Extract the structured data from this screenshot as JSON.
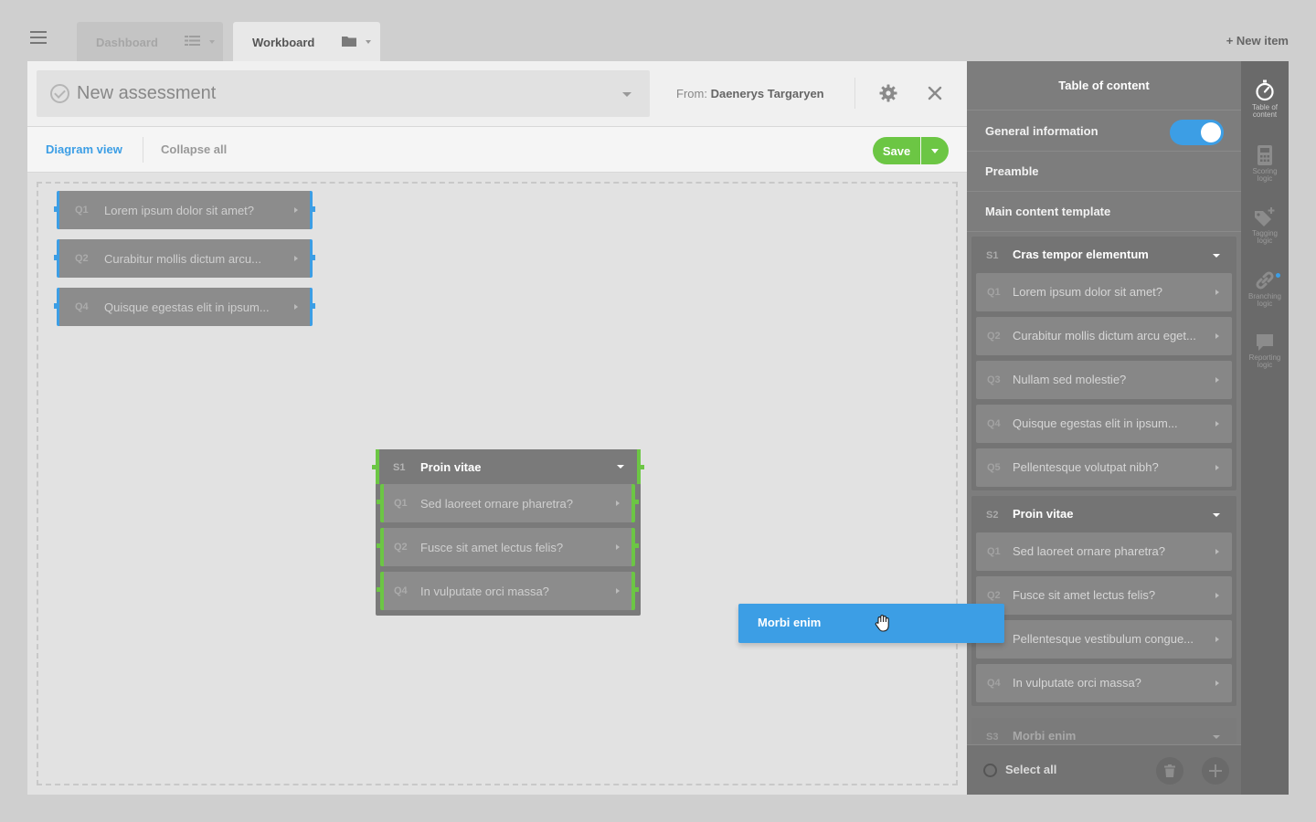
{
  "topbar": {
    "tabs": [
      {
        "label": "Dashboard",
        "icon": "grid-icon"
      },
      {
        "label": "Workboard",
        "icon": "folder-icon"
      }
    ],
    "new_item": "+ New item"
  },
  "header": {
    "title_placeholder": "New assessment",
    "from_label": "From:",
    "from_name": "Daenerys Targaryen"
  },
  "toolbar": {
    "diagram_view": "Diagram view",
    "collapse_all": "Collapse all",
    "save_label": "Save"
  },
  "canvas": {
    "loose_questions": [
      {
        "num": "Q1",
        "text": "Lorem ipsum dolor sit amet?"
      },
      {
        "num": "Q2",
        "text": "Curabitur mollis dictum arcu..."
      },
      {
        "num": "Q4",
        "text": "Quisque egestas elit in ipsum..."
      }
    ],
    "section": {
      "num": "S1",
      "title": "Proin vitae",
      "questions": [
        {
          "num": "Q1",
          "text": "Sed laoreet ornare pharetra?"
        },
        {
          "num": "Q2",
          "text": "Fusce sit amet lectus felis?"
        },
        {
          "num": "Q4",
          "text": "In vulputate orci massa?"
        }
      ]
    },
    "dragging": "Morbi enim"
  },
  "toc": {
    "title": "Table of content",
    "rows": [
      "General information",
      "Preamble",
      "Main content template"
    ],
    "general_info_enabled": true,
    "sections": [
      {
        "num": "S1",
        "title": "Cras tempor elementum",
        "questions": [
          {
            "num": "Q1",
            "text": "Lorem ipsum dolor sit amet?"
          },
          {
            "num": "Q2",
            "text": "Curabitur mollis dictum arcu eget..."
          },
          {
            "num": "Q3",
            "text": "Nullam sed molestie?"
          },
          {
            "num": "Q4",
            "text": "Quisque egestas elit in ipsum..."
          },
          {
            "num": "Q5",
            "text": "Pellentesque volutpat nibh?"
          }
        ]
      },
      {
        "num": "S2",
        "title": "Proin vitae",
        "questions": [
          {
            "num": "Q1",
            "text": "Sed laoreet ornare pharetra?"
          },
          {
            "num": "Q2",
            "text": "Fusce sit amet lectus felis?"
          },
          {
            "num": "",
            "text": "Pellentesque vestibulum congue..."
          },
          {
            "num": "Q4",
            "text": "In vulputate orci massa?"
          }
        ]
      },
      {
        "num": "S3",
        "title": "Morbi enim"
      }
    ],
    "select_all": "Select all"
  },
  "rail": [
    {
      "label": "Table of content",
      "icon": "compass-icon"
    },
    {
      "label": "Scoring logic",
      "icon": "calculator-icon"
    },
    {
      "label": "Tagging logic",
      "icon": "tag-icon"
    },
    {
      "label": "Branching logic",
      "icon": "link-icon"
    },
    {
      "label": "Reporting logic",
      "icon": "chat-icon"
    }
  ],
  "colors": {
    "accent_blue": "#3c9ee5",
    "accent_green": "#6cc644"
  }
}
